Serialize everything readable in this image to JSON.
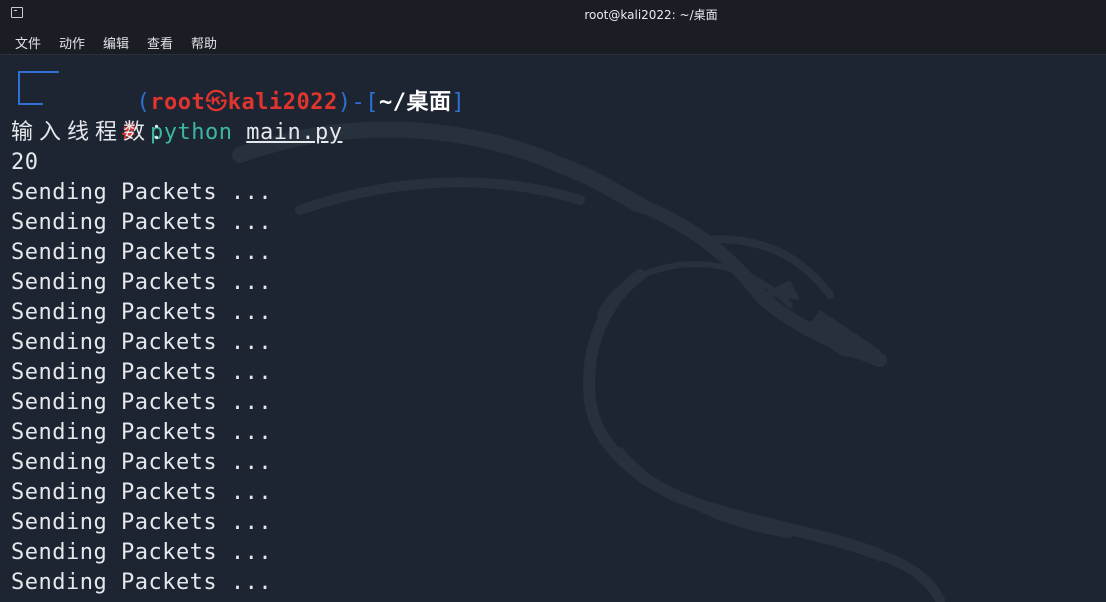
{
  "window": {
    "title": "root@kali2022: ~/桌面"
  },
  "menu": {
    "items": [
      "文件",
      "动作",
      "编辑",
      "查看",
      "帮助"
    ]
  },
  "prompt": {
    "open_paren": "(",
    "user": "root",
    "skull": "㉿",
    "host": "kali2022",
    "close_paren": ")",
    "dash": "-",
    "open_bracket": "[",
    "path": "~/桌面",
    "close_bracket": "]",
    "hash": "#",
    "command": "python",
    "argument": "main.py"
  },
  "output": {
    "question": "输入线程数：",
    "answer": "20",
    "lines": [
      "Sending Packets ...",
      "Sending Packets ...",
      "Sending Packets ...",
      "Sending Packets ...",
      "Sending Packets ...",
      "Sending Packets ...",
      "Sending Packets ...",
      "Sending Packets ...",
      "Sending Packets ...",
      "Sending Packets ...",
      "Sending Packets ...",
      "Sending Packets ...",
      "Sending Packets ...",
      "Sending Packets ..."
    ]
  },
  "colors": {
    "background": "#1e2532",
    "prompt_red": "#e0342f",
    "bracket_blue": "#2f6fd3",
    "command_teal": "#3cb7a3"
  }
}
